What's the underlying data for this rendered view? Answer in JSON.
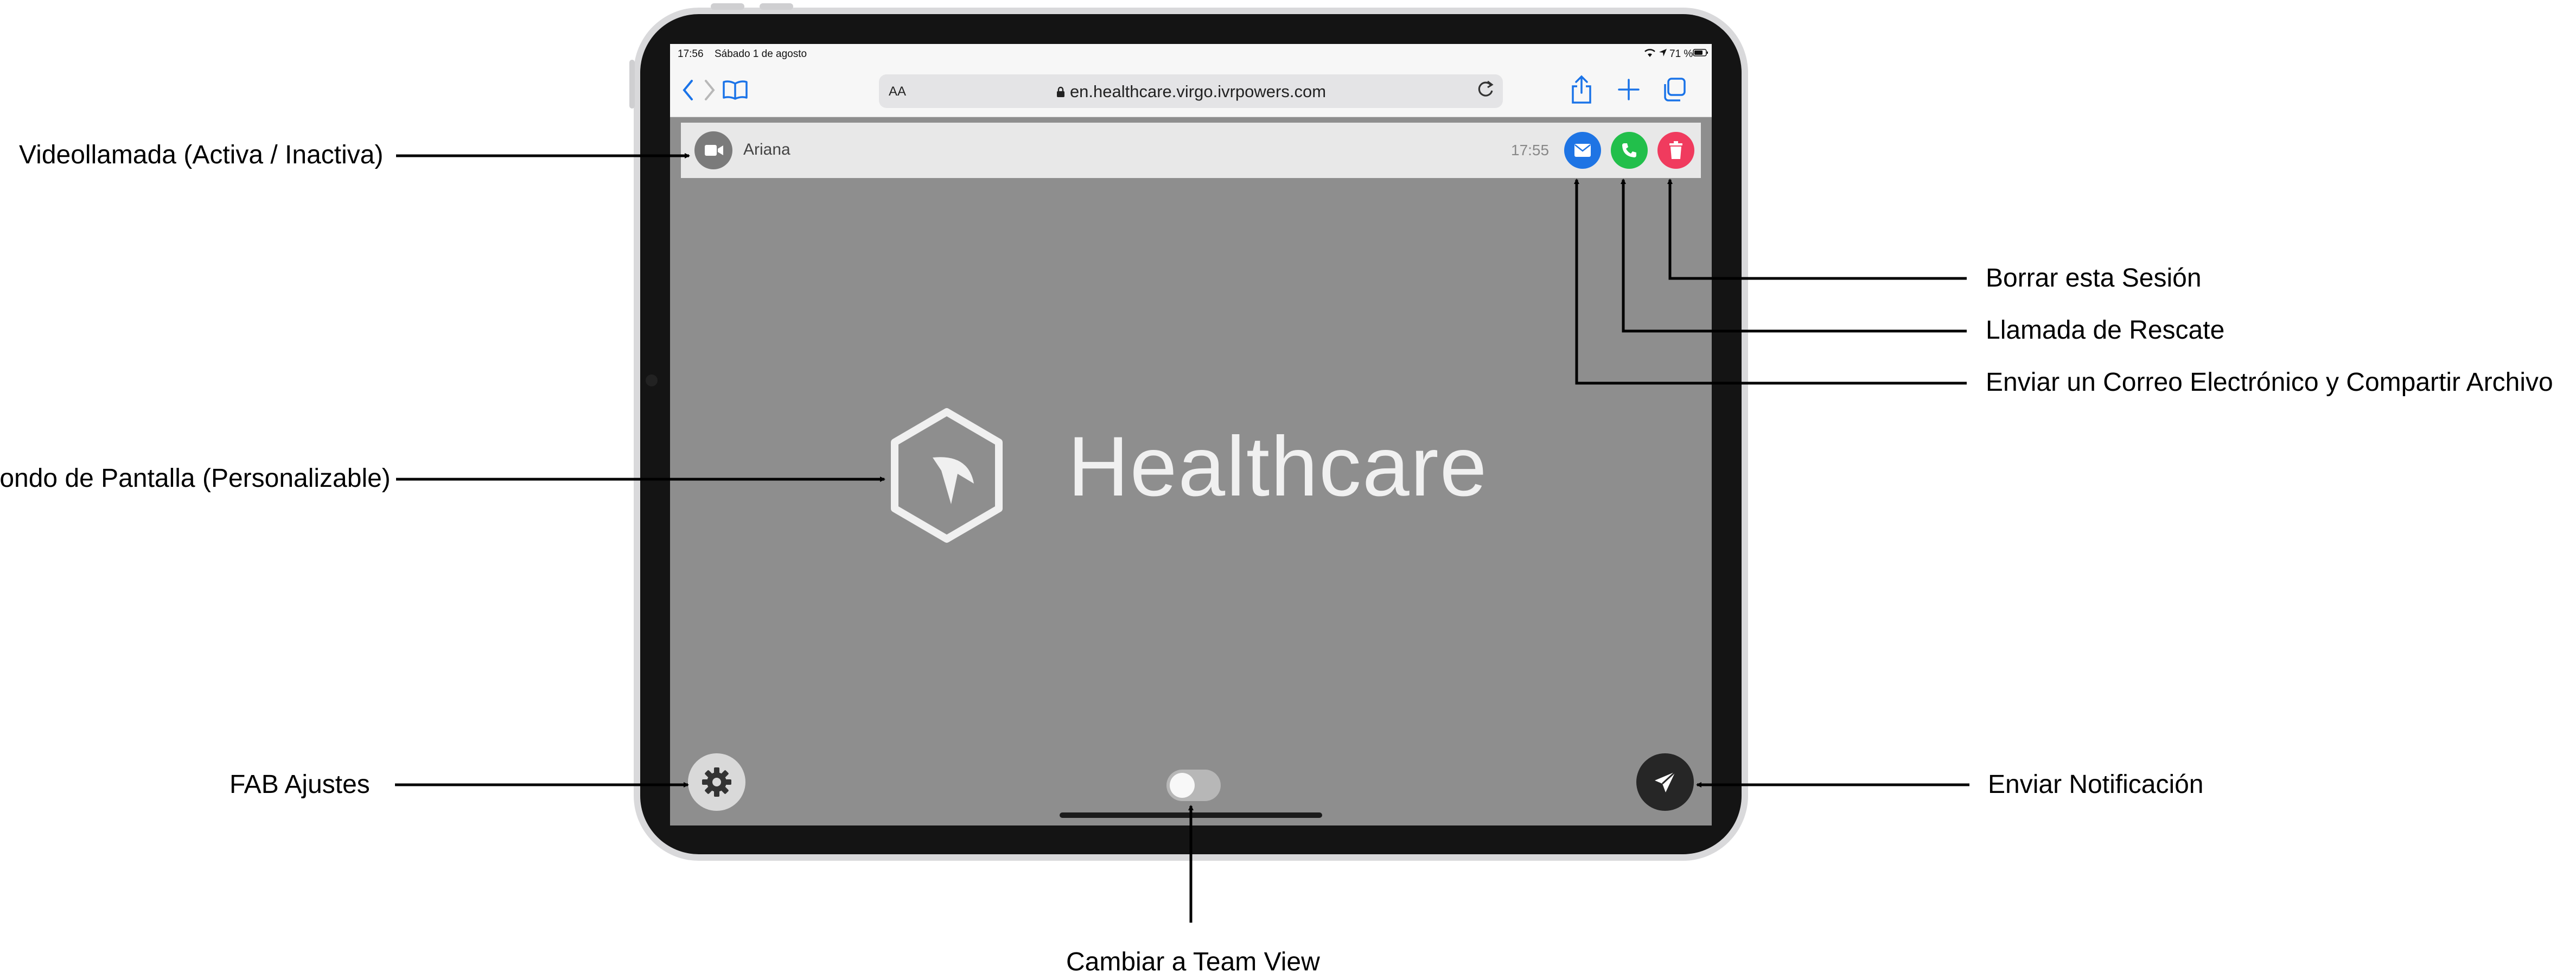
{
  "status_bar": {
    "time": "17:56",
    "date": "Sábado 1 de agosto",
    "battery": "71 %"
  },
  "browser": {
    "url": "en.healthcare.virgo.ivrpowers.com",
    "text_size_label": "AA",
    "icons": [
      "back-icon",
      "forward-icon",
      "bookmarks-icon",
      "lock-icon",
      "reload-icon",
      "share-icon",
      "new-tab-icon",
      "tabs-icon"
    ]
  },
  "session": {
    "name": "Ariana",
    "time": "17:55"
  },
  "brand": {
    "name": "Healthcare"
  },
  "colors": {
    "email": "#1e74e4",
    "call": "#22bf4b",
    "delete": "#f03b5e",
    "background": "#8e8e8e"
  },
  "annotations": {
    "video_call": "Videollamada (Activa / Inactiva)",
    "background": "Fondo de Pantalla (Personalizable)",
    "settings": "FAB Ajustes",
    "delete_session": "Borrar esta Sesión",
    "rescue_call": "Llamada de Rescate",
    "email_share": "Enviar un Correo Electrónico y Compartir Archivo",
    "send_notification": "Enviar Notificación",
    "team_view": "Cambiar a Team View"
  }
}
